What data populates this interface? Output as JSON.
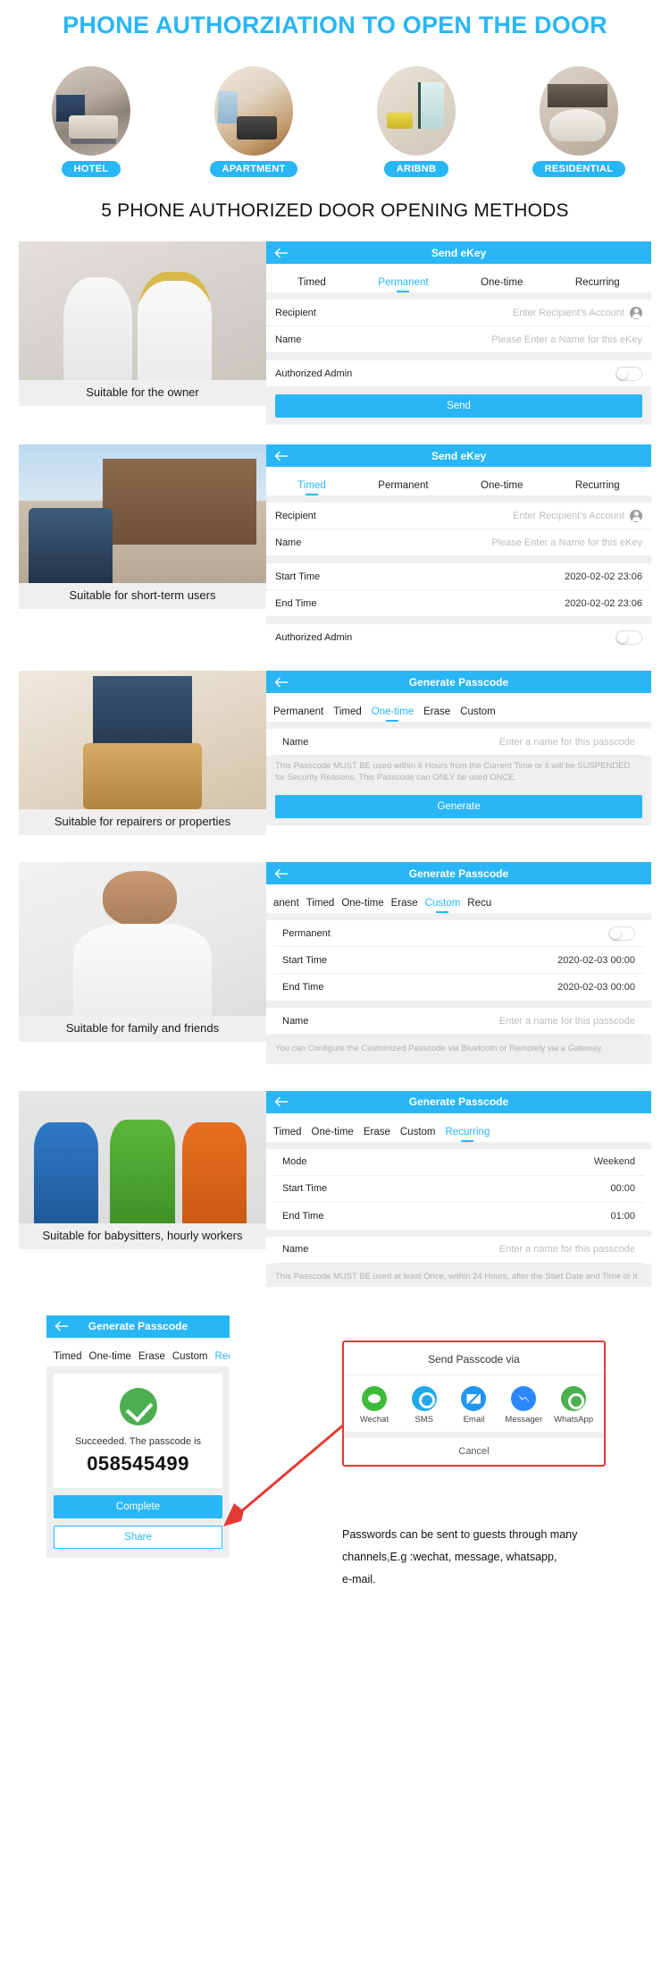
{
  "hero": {
    "title": "PHONE  AUTHORZIATION TO OPEN THE DOOR",
    "scenes": [
      {
        "label": "HOTEL",
        "icon": "hotel-room-photo"
      },
      {
        "label": "APARTMENT",
        "icon": "apartment-room-photo"
      },
      {
        "label": "ARIBNB",
        "icon": "airbnb-room-photo"
      },
      {
        "label": "RESIDENTIAL",
        "icon": "residential-room-photo"
      }
    ]
  },
  "section_heading": "5 PHONE AUTHORIZED DOOR OPENING METHODS",
  "accent": "#29b6f6",
  "cards": [
    {
      "caption": "Suitable for the owner",
      "phone": {
        "title": "Send eKey",
        "back_icon": "back-arrow-icon",
        "tabs": [
          {
            "label": "Timed",
            "active": false
          },
          {
            "label": "Permanent",
            "active": true
          },
          {
            "label": "One-time",
            "active": false
          },
          {
            "label": "Recurring",
            "active": false
          }
        ],
        "rows": [
          {
            "label": "Recipient",
            "placeholder": "Enter Recipient's Account",
            "icon": "contact-avatar-icon"
          },
          {
            "label": "Name",
            "placeholder": "Please Enter a Name for this eKey"
          }
        ],
        "toggle_row": {
          "label": "Authorized Admin",
          "on": false
        },
        "button": "Send"
      }
    },
    {
      "caption": "Suitable for short-term users",
      "phone": {
        "title": "Send eKey",
        "back_icon": "back-arrow-icon",
        "tabs": [
          {
            "label": "Timed",
            "active": true
          },
          {
            "label": "Permanent",
            "active": false
          },
          {
            "label": "One-time",
            "active": false
          },
          {
            "label": "Recurring",
            "active": false
          }
        ],
        "rows": [
          {
            "label": "Recipient",
            "placeholder": "Enter Recipient's Account",
            "icon": "contact-avatar-icon"
          },
          {
            "label": "Name",
            "placeholder": "Please Enter a Name for this eKey"
          }
        ],
        "time_rows": [
          {
            "label": "Start Time",
            "value": "2020-02-02 23:06"
          },
          {
            "label": "End Time",
            "value": "2020-02-02 23:06"
          }
        ],
        "toggle_row": {
          "label": "Authorized Admin",
          "on": false
        }
      }
    },
    {
      "caption": "Suitable for repairers or properties",
      "phone": {
        "title": "Generate Passcode",
        "back_icon": "back-arrow-icon",
        "tabs": [
          {
            "label": "Permanent",
            "active": false
          },
          {
            "label": "Timed",
            "active": false
          },
          {
            "label": "One-time",
            "active": true
          },
          {
            "label": "Erase",
            "active": false
          },
          {
            "label": "Custom",
            "active": false
          }
        ],
        "rows": [
          {
            "label": "Name",
            "placeholder": "Enter a name for this passcode"
          }
        ],
        "note": "This Passcode MUST BE used within 6 Hours from the Current Time or it will be SUSPENDED for Security Reasons. This Passcode can ONLY be used ONCE.",
        "button": "Generate"
      }
    },
    {
      "caption": "Suitable for family and friends",
      "phone": {
        "title": "Generate Passcode",
        "back_icon": "back-arrow-icon",
        "tabs": [
          {
            "label": "anent",
            "active": false
          },
          {
            "label": "Timed",
            "active": false
          },
          {
            "label": "One-time",
            "active": false
          },
          {
            "label": "Erase",
            "active": false
          },
          {
            "label": "Custom",
            "active": true
          },
          {
            "label": "Recu",
            "active": false
          }
        ],
        "toggle_row": {
          "label": "Permanent",
          "on": false
        },
        "time_rows": [
          {
            "label": "Start Time",
            "value": "2020-02-03 00:00"
          },
          {
            "label": "End Time",
            "value": "2020-02-03 00:00"
          }
        ],
        "rows": [
          {
            "label": "Name",
            "placeholder": "Enter a name for this passcode"
          }
        ],
        "note": "You can Configure the Customized Passcode via Bluetooth or Remotely via a Gateway."
      }
    },
    {
      "caption": "Suitable for babysitters, hourly workers",
      "phone": {
        "title": "Generate Passcode",
        "back_icon": "back-arrow-icon",
        "tabs": [
          {
            "label": "Timed",
            "active": false
          },
          {
            "label": "One-time",
            "active": false
          },
          {
            "label": "Erase",
            "active": false
          },
          {
            "label": "Custom",
            "active": false
          },
          {
            "label": "Recurring",
            "active": true
          }
        ],
        "time_rows": [
          {
            "label": "Mode",
            "value": "Weekend"
          },
          {
            "label": "Start Time",
            "value": "00:00"
          },
          {
            "label": "End Time",
            "value": "01:00"
          }
        ],
        "rows": [
          {
            "label": "Name",
            "placeholder": "Enter a name for this passcode"
          }
        ],
        "note": "This Passcode MUST BE used at least Once, within 24 Hours, after the Start Date and Time or it"
      }
    }
  ],
  "bottom": {
    "phone": {
      "title": "Generate Passcode",
      "back_icon": "back-arrow-icon",
      "tabs": [
        {
          "label": "Timed",
          "active": false
        },
        {
          "label": "One-time",
          "active": false
        },
        {
          "label": "Erase",
          "active": false
        },
        {
          "label": "Custom",
          "active": false
        },
        {
          "label": "Recurring",
          "active": true
        }
      ],
      "success_icon": "success-check-icon",
      "success_text": "Succeeded. The passcode is",
      "passcode": "058545499",
      "complete_button": "Complete",
      "share_button": "Share"
    },
    "share_dialog": {
      "title": "Send Passcode via",
      "border_color": "#e53935",
      "channels": [
        {
          "name": "Wechat",
          "icon": "wechat-icon"
        },
        {
          "name": "SMS",
          "icon": "sms-icon"
        },
        {
          "name": "Email",
          "icon": "email-icon"
        },
        {
          "name": "Messager",
          "icon": "messenger-icon"
        },
        {
          "name": "WhatsApp",
          "icon": "whatsapp-icon"
        }
      ],
      "cancel": "Cancel"
    },
    "note_line1": "Passwords can be sent to guests through many",
    "note_line2": "channels,E.g :wechat,  message,  whatsapp,",
    "note_line3": "e-mail."
  }
}
